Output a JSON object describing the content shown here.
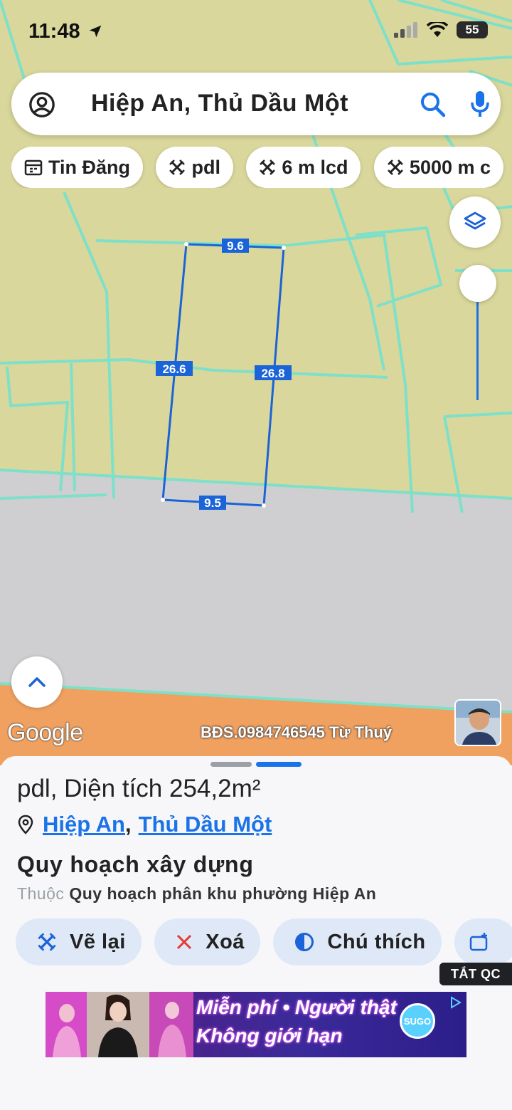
{
  "status_bar": {
    "time": "11:48",
    "battery": "55"
  },
  "search": {
    "query": "Hiệp An, Thủ Dầu Một"
  },
  "chips": [
    {
      "label": "Tin Đăng",
      "icon": "calendar-icon"
    },
    {
      "label": "pdl",
      "icon": "measure-icon"
    },
    {
      "label": "6 m lcd",
      "icon": "measure-icon"
    },
    {
      "label": "5000 m c",
      "icon": "measure-icon"
    }
  ],
  "map": {
    "measurements": {
      "top": "9.6",
      "left": "26.6",
      "right": "26.8",
      "bottom": "9.5"
    },
    "google_logo": "Google",
    "watermark": "BĐS.0984746545 Từ Thuý",
    "colors": {
      "residential": "#d9d79b",
      "road": "#cfcfd1",
      "planning": "#f0a160",
      "boundary": "#7ee0c8",
      "plot_line": "#1a63d8"
    }
  },
  "sheet": {
    "title": "pdl, Diện tích 254,2m²",
    "location": {
      "ward": "Hiệp An",
      "separator": ",",
      "city": "Thủ Dầu Một"
    },
    "section_title": "Quy hoạch xây dựng",
    "section_prefix": "Thuộc",
    "section_value": "Quy hoạch phân khu phường Hiệp An",
    "actions": [
      {
        "label": "Vẽ lại",
        "icon": "measure-icon"
      },
      {
        "label": "Xoá",
        "icon": "close-icon"
      },
      {
        "label": "Chú thích",
        "icon": "contrast-icon"
      }
    ]
  },
  "ad": {
    "close_label": "TẮT QC",
    "line1": "Miễn phí • Người thật",
    "line2": "Không giới hạn",
    "logo": "SUGO"
  }
}
